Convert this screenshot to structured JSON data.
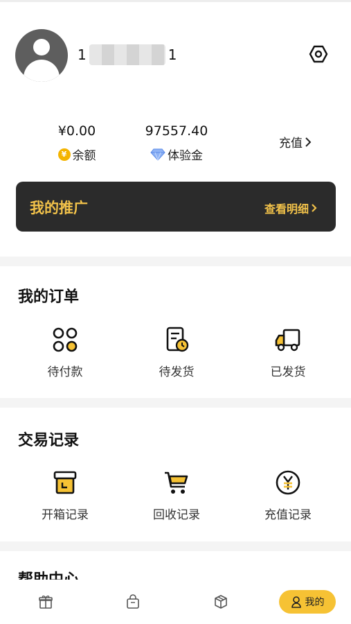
{
  "profile": {
    "username_start": "1",
    "username_end": "1",
    "avatar_icon": "user-avatar-icon",
    "settings_icon": "hexagon-settings-icon"
  },
  "wallet": {
    "balance_value": "¥0.00",
    "balance_label": "余额",
    "balance_icon": "yen-coin-icon",
    "trial_value": "97557.40",
    "trial_label": "体验金",
    "trial_icon": "diamond-icon",
    "recharge_label": "充值",
    "recharge_icon": "chevron-right-icon"
  },
  "promotion": {
    "title": "我的推广",
    "detail_label": "查看明细"
  },
  "orders": {
    "title": "我的订单",
    "items": [
      {
        "label": "待付款",
        "icon": "grid-clover-icon"
      },
      {
        "label": "待发货",
        "icon": "document-clock-icon"
      },
      {
        "label": "已发货",
        "icon": "truck-icon"
      }
    ]
  },
  "transactions": {
    "title": "交易记录",
    "items": [
      {
        "label": "开箱记录",
        "icon": "box-open-icon"
      },
      {
        "label": "回收记录",
        "icon": "cart-icon"
      },
      {
        "label": "充值记录",
        "icon": "yen-circle-icon"
      }
    ]
  },
  "help": {
    "title": "帮助中心"
  },
  "tabbar": {
    "items": [
      {
        "icon": "gift-icon"
      },
      {
        "icon": "shopping-bag-icon"
      },
      {
        "icon": "cube-box-icon"
      }
    ],
    "active_label": "我的",
    "active_icon": "user-outline-icon"
  },
  "colors": {
    "accent": "#f6c234",
    "promo_background": "#2b2b2b",
    "promo_text": "#f2c24a",
    "divider": "#f4f4f4"
  }
}
